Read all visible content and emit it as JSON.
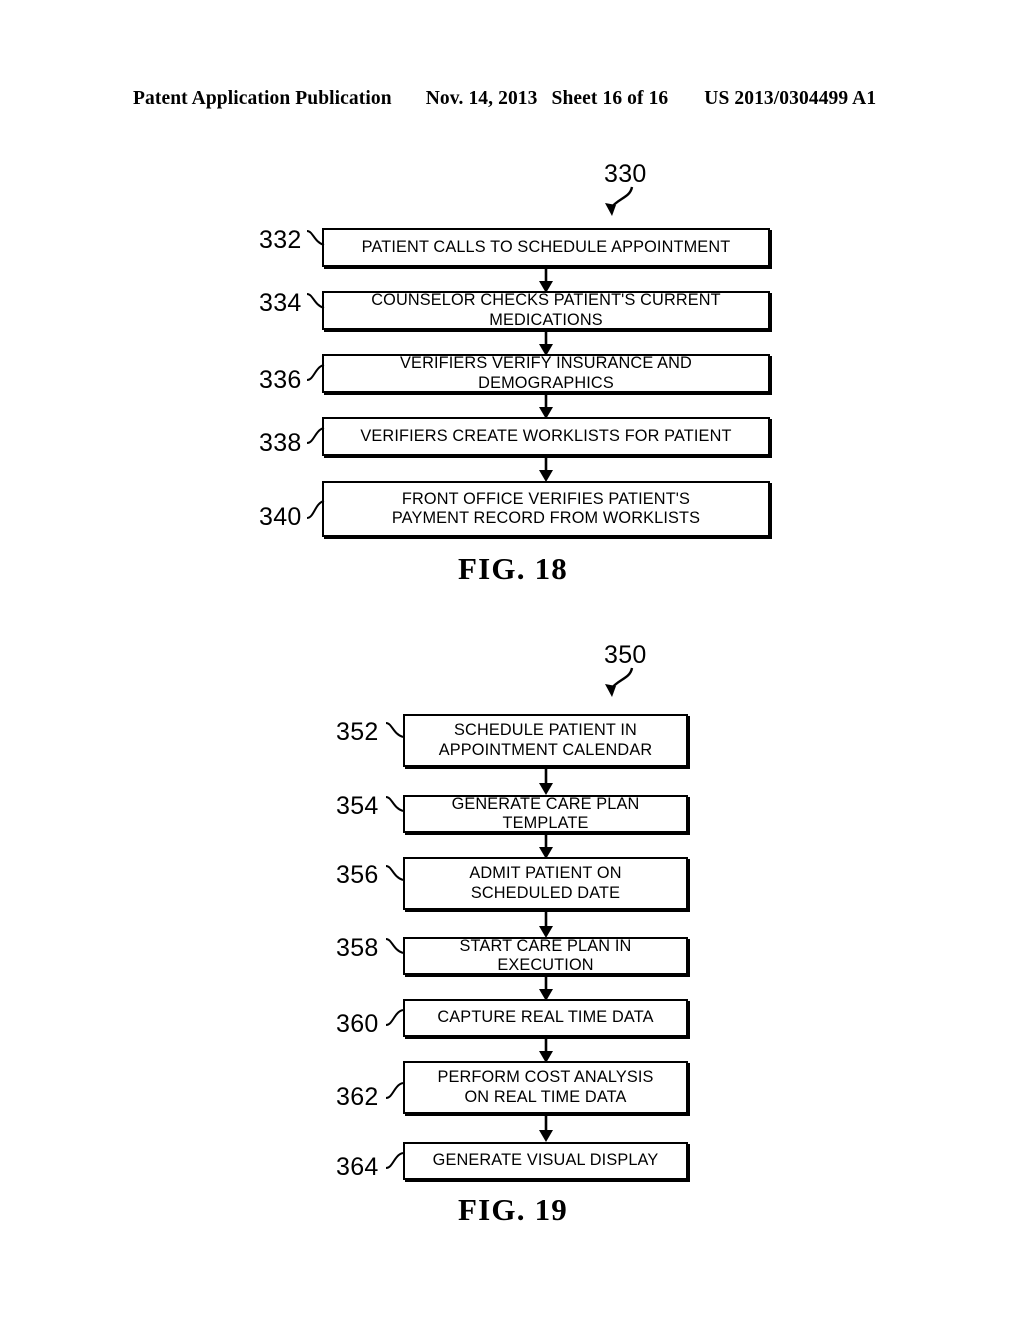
{
  "header": {
    "publication": "Patent Application Publication",
    "date": "Nov. 14, 2013",
    "sheet": "Sheet 16 of 16",
    "patent_number": "US 2013/0304499 A1"
  },
  "figures": [
    {
      "id": "fig-18",
      "caption": "FIG. 18",
      "diagram_ref": "330",
      "steps": [
        {
          "ref": "332",
          "text": "PATIENT CALLS TO SCHEDULE APPOINTMENT"
        },
        {
          "ref": "334",
          "text": "COUNSELOR CHECKS PATIENT'S CURRENT MEDICATIONS"
        },
        {
          "ref": "336",
          "text": "VERIFIERS VERIFY INSURANCE AND DEMOGRAPHICS"
        },
        {
          "ref": "338",
          "text": "VERIFIERS CREATE WORKLISTS FOR PATIENT"
        },
        {
          "ref": "340",
          "text": "FRONT OFFICE VERIFIES PATIENT'S\nPAYMENT RECORD FROM WORKLISTS"
        }
      ]
    },
    {
      "id": "fig-19",
      "caption": "FIG. 19",
      "diagram_ref": "350",
      "steps": [
        {
          "ref": "352",
          "text": "SCHEDULE PATIENT IN\nAPPOINTMENT CALENDAR"
        },
        {
          "ref": "354",
          "text": "GENERATE CARE PLAN TEMPLATE"
        },
        {
          "ref": "356",
          "text": "ADMIT PATIENT ON\nSCHEDULED DATE"
        },
        {
          "ref": "358",
          "text": "START CARE PLAN IN EXECUTION"
        },
        {
          "ref": "360",
          "text": "CAPTURE REAL TIME DATA"
        },
        {
          "ref": "362",
          "text": "PERFORM COST ANALYSIS\nON REAL TIME DATA"
        },
        {
          "ref": "364",
          "text": "GENERATE VISUAL DISPLAY"
        }
      ]
    }
  ]
}
